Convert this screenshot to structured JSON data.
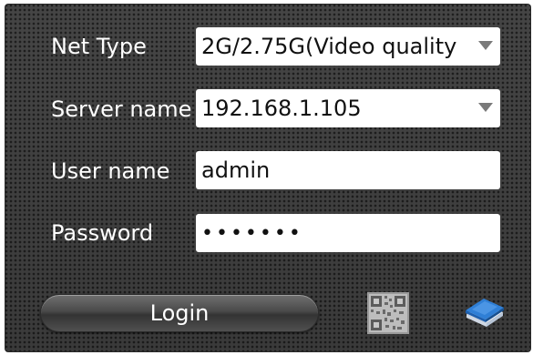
{
  "form": {
    "net_type": {
      "label": "Net Type",
      "value": "2G/2.75G(Video quality"
    },
    "server_name": {
      "label": "Server name",
      "value": "192.168.1.105"
    },
    "user_name": {
      "label": "User name",
      "value": "admin"
    },
    "password": {
      "label": "Password",
      "value": "•••••••"
    }
  },
  "actions": {
    "login_label": "Login"
  },
  "icons": {
    "qr": "qr-code-icon",
    "book": "book-icon",
    "dropdown": "chevron-down-icon"
  }
}
